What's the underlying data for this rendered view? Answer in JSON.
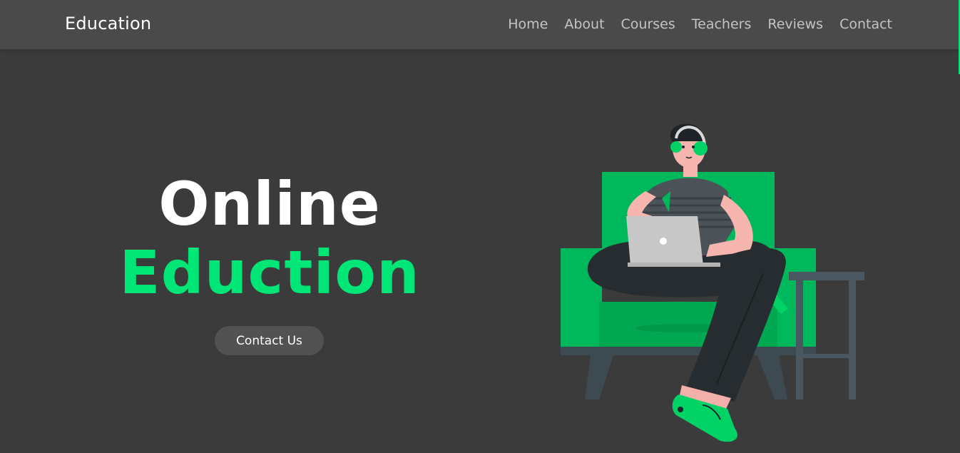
{
  "navbar": {
    "brand": "Education",
    "links": [
      {
        "label": "Home"
      },
      {
        "label": "About"
      },
      {
        "label": "Courses"
      },
      {
        "label": "Teachers"
      },
      {
        "label": "Reviews"
      },
      {
        "label": "Contact"
      }
    ]
  },
  "hero": {
    "title_line1": "Online",
    "title_line2": "Eduction",
    "cta_label": "Contact Us",
    "illustration": "person-on-sofa-with-laptop-illustration"
  },
  "colors": {
    "accent": "#00e676",
    "background": "#3b3b3b",
    "navbar": "#4a4a4a"
  }
}
